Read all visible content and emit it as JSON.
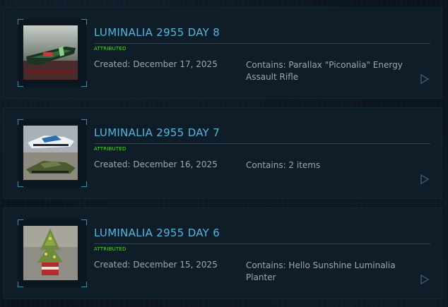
{
  "pledges": [
    {
      "title": "LUMINALIA 2955 DAY 8",
      "badge": "ATTRIBUTED",
      "created": "Created: December 17, 2025",
      "contains": "Contains: Parallax \"Piconalia\" Energy Assault Rifle",
      "thumb_icon": "rifle-thumbnail"
    },
    {
      "title": "LUMINALIA 2955 DAY 7",
      "badge": "ATTRIBUTED",
      "created": "Created: December 16, 2025",
      "contains": "Contains: 2 items",
      "thumb_icon": "vehicle-thumbnail"
    },
    {
      "title": "LUMINALIA 2955 DAY 6",
      "badge": "ATTRIBUTED",
      "created": "Created: December 15, 2025",
      "contains": "Contains: Hello Sunshine Luminalia Planter",
      "thumb_icon": "planter-thumbnail"
    }
  ],
  "colors": {
    "title": "#57b6dc",
    "badge": "#4fdc2e",
    "body_text": "#9aa7b1",
    "frame_accent": "#3a8fb0"
  }
}
